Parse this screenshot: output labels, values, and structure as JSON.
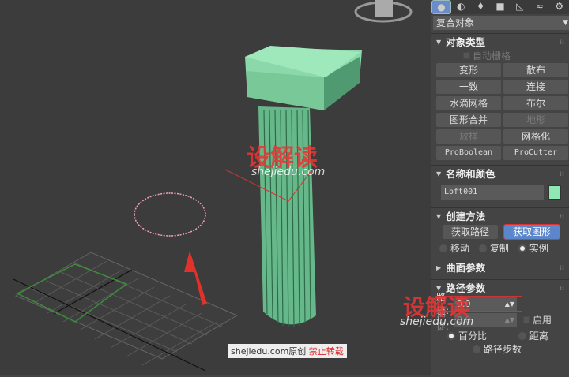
{
  "panel": {
    "category": "复合对象",
    "object_type": {
      "title": "对象类型",
      "auto_grid": "自动栅格",
      "buttons": [
        {
          "label": "变形"
        },
        {
          "label": "散布"
        },
        {
          "label": "一致"
        },
        {
          "label": "连接"
        },
        {
          "label": "水滴网格"
        },
        {
          "label": "布尔"
        },
        {
          "label": "图形合并"
        },
        {
          "label": "地形"
        },
        {
          "label": "放样"
        },
        {
          "label": "网格化"
        },
        {
          "label": "ProBoolean"
        },
        {
          "label": "ProCutter"
        }
      ]
    },
    "name_color": {
      "title": "名称和颜色",
      "name": "Loft001",
      "color": "#8ee8b4"
    },
    "creation": {
      "title": "创建方法",
      "get_path": "获取路径",
      "get_shape": "获取图形",
      "move": "移动",
      "copy": "复制",
      "instance": "实例"
    },
    "surface": {
      "title": "曲面参数"
    },
    "path_params": {
      "title": "路径参数",
      "path_label": "路径:",
      "path_value": "0.0",
      "snap_label": "捕捉:",
      "snap_value": "0.0",
      "enable": "启用",
      "percent": "百分比",
      "distance": "距离",
      "path_steps": "路径步数"
    }
  },
  "watermark": {
    "logo": "设解读",
    "site": "shejiedu.com",
    "footer_site": "shejiedu.com",
    "footer_orig": "原创",
    "footer_ban": "禁止转载"
  }
}
